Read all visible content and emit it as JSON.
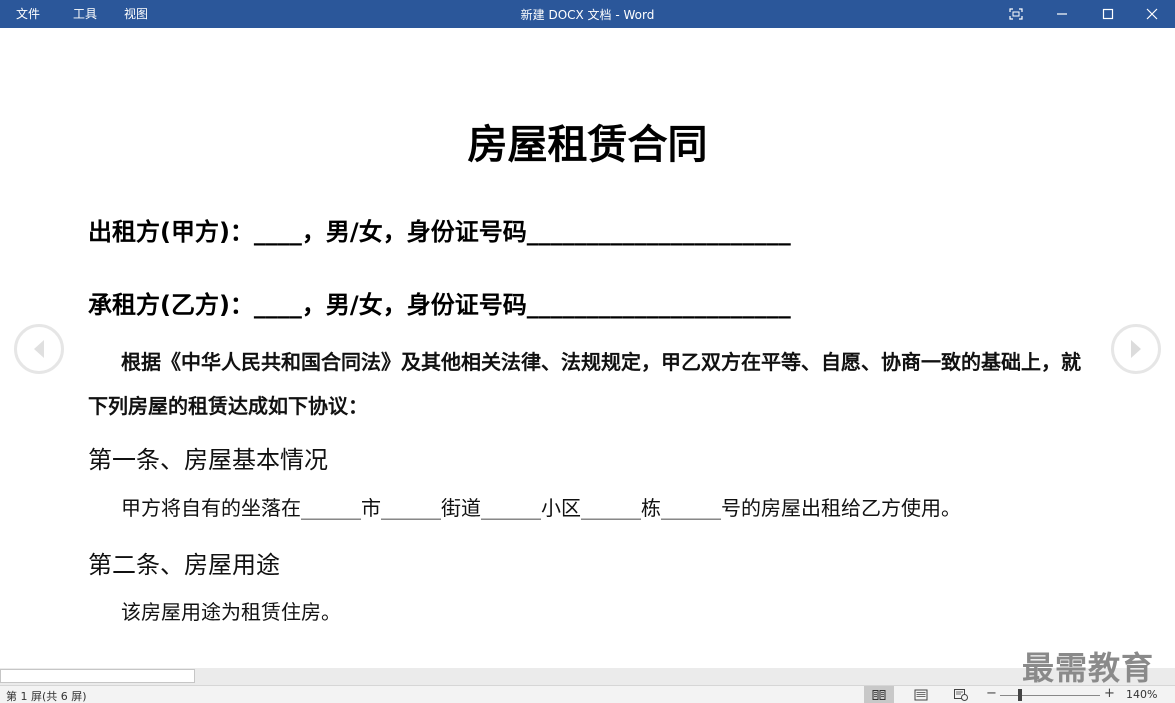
{
  "titlebar": {
    "menu": [
      "文件",
      "工具",
      "视图"
    ],
    "title": "新建 DOCX 文档  -  Word"
  },
  "document": {
    "heading": "房屋租赁合同",
    "party_a": "出租方(甲方)：____，男/女，身份证号码______________________",
    "party_b": "承租方(乙方)：____，男/女，身份证号码______________________",
    "preamble": "根据《中华人民共和国合同法》及其他相关法律、法规规定，甲乙双方在平等、自愿、协商一致的基础上，就下列房屋的租赁达成如下协议：",
    "article1_title": "第一条、房屋基本情况",
    "article1_body": "甲方将自有的坐落在______市______街道______小区______栋______号的房屋出租给乙方使用。",
    "article2_title": "第二条、房屋用途",
    "article2_body": "该房屋用途为租赁住房。"
  },
  "watermark": "最需教育",
  "statusbar": {
    "page_count": "第 1 屏(共 6 屏)",
    "zoom_minus": "−",
    "zoom_plus": "+",
    "zoom_level": "140%",
    "zoom_fraction": 0.2
  },
  "icons": {
    "restore": "focus-mode-icon",
    "minimize": "minimize-icon",
    "maximize": "maximize-icon",
    "close": "close-icon",
    "prev": "chevron-left-icon",
    "next": "chevron-right-icon",
    "read_mode": "read-mode-icon",
    "print_layout": "print-layout-icon",
    "web_layout": "web-layout-icon"
  },
  "colors": {
    "titlebar": "#2b579a",
    "text": "#000000",
    "statusbar": "#f3f3f3"
  }
}
